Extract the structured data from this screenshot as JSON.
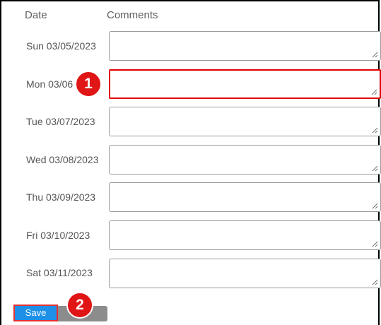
{
  "header": {
    "date_label": "Date",
    "comments_label": "Comments"
  },
  "rows": [
    {
      "date": "Sun 03/05/2023",
      "comment": ""
    },
    {
      "date": "Mon 03/06",
      "comment": ""
    },
    {
      "date": "Tue 03/07/2023",
      "comment": ""
    },
    {
      "date": "Wed 03/08/2023",
      "comment": ""
    },
    {
      "date": "Thu 03/09/2023",
      "comment": ""
    },
    {
      "date": "Fri 03/10/2023",
      "comment": ""
    },
    {
      "date": "Sat 03/11/2023",
      "comment": ""
    }
  ],
  "actions": {
    "save_label": "Save"
  },
  "callouts": {
    "step1": "1",
    "step2": "2"
  },
  "colors": {
    "save_button": "#1e90e8",
    "highlight": "#e00000",
    "callout": "#e01515",
    "secondary_button": "#8c8c8c"
  },
  "icons": {
    "resize_grip": "resize-grip-icon"
  }
}
